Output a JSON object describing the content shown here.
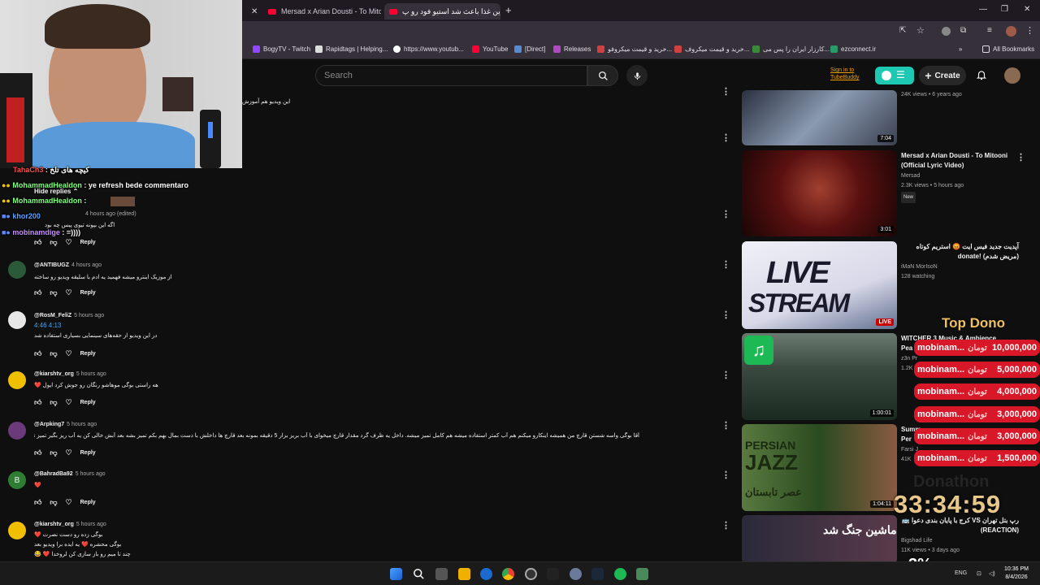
{
  "browser": {
    "tabs": [
      {
        "title": "Mersad x Arian Dousti - To Mito",
        "active": false
      },
      {
        "title": "این غذا باعث شد استیو فود رو پ",
        "active": true
      }
    ],
    "bookmarks": [
      "BogyTV - Twitch",
      "Rapidtags | Helping...",
      "https://www.youtub...",
      "YouTube",
      "[Direct]",
      "Releases",
      "خرید و قیمت میکروفو...",
      "خرید و قیمت میکروف...",
      "کارزار ایران را پس می...",
      "ezconnect.ir"
    ],
    "all_bookmarks": "All Bookmarks"
  },
  "header": {
    "search_placeholder": "Search",
    "signin_line1": "Sign in to",
    "signin_line2": "TubeBuddy",
    "create_label": "Create"
  },
  "comments": [
    {
      "author": "@ANTIBUGZ",
      "time": "4 hours ago",
      "text": "از موزیک اینترو میشه فهمید یه ادم با سلیقه ویدیو رو ساخته",
      "avatar_color": "#2a5a3a"
    },
    {
      "author": "@RosM_FeliZ",
      "time": "5 hours ago",
      "timestamps": "4:46  4:13",
      "text": "در این ویدیو از حقه‌های سینمایی بسیاری استفاده شد",
      "avatar_color": "#e8e8e8"
    },
    {
      "author": "@kiarshtv_org",
      "time": "5 hours ago",
      "text": "هه راستی بوگی موهاشو رنگان رو جوش کرد ایول ❤️",
      "avatar_color": "#f0c000"
    },
    {
      "author": "@Arpking7",
      "time": "5 hours ago",
      "text": "آقا بوگی واسه شستن قارچ من همیشه اینکارو میکنم هم آب کمتر استفاده میشه هم کامل تمیز میشه. داخل یه ظرف گرد مقدار قارچ میخوای با آب بریز بزار 5 دقیقه بمونه بعد قارچ ها داخلش با دست بمال بهم بکم تمیز بشه بعد آبش خالی کن یه آب ریز بگیر تمیز تمیز میشه",
      "avatar_color": "#6a3a7a"
    },
    {
      "author": "@BahradBa92",
      "time": "5 hours ago",
      "text": "❤️",
      "avatar_color": "#2e7d32",
      "avatar_letter": "B"
    },
    {
      "author": "@kiarshtv_org",
      "time": "5 hours ago",
      "text": "بوگی زده رو دست نصرت ❤️",
      "text2": "بوگی محشره ❤️ یه ایده برا ویدیو بعد",
      "text3": "چند تا میم رو باز سازی کن لروخدا ❤️ 😂",
      "avatar_color": "#f0c000"
    }
  ],
  "partial_comment": {
    "time": "4 hours ago (edited)",
    "text": "اگه این بپونه تیوی پیس چه بود",
    "top_text": "این ویدیو هم آموزش"
  },
  "comment_actions": {
    "reply": "Reply",
    "hide_replies": "Hide replies"
  },
  "sidebar": [
    {
      "title": "",
      "meta1": "24K views • 6 years ago",
      "duration": "7:04",
      "thumb": "#4a5a70"
    },
    {
      "title": "Mersad x Arian Dousti - To Mitooni (Official Lyric Video)",
      "channel": "Mersad",
      "meta1": "2.3K views • 5 hours ago",
      "badge": "New",
      "duration": "3:01",
      "thumb": "#5a1010"
    },
    {
      "title": "آپدیت جدید فیس ایت 😡 استریم کوتاه (مریض شدم) !donate",
      "channel": "iMaN MorIsoN",
      "meta1": "128 watching",
      "live": "LIVE",
      "thumb": "#e8e8f0"
    },
    {
      "title": "WITCHER 3 Music & Ambience",
      "title2": "Pea",
      "channel": "z3n Pr",
      "meta1": "1.2K",
      "duration": "1:00:01",
      "thumb": "#3a4a40"
    },
    {
      "title": "Summ",
      "title2": "Per",
      "channel": "Farsi J",
      "meta1": "41K",
      "duration": "1:04:11",
      "thumb": "#3a5a30",
      "thumb_text1": "PERSIAN",
      "thumb_text2": "JAZZ",
      "thumb_text3": "عصر تابستان"
    },
    {
      "title": "رپ بتل تهران VS کرج با پایان بندی دعوا 🚌 (REACTION)",
      "channel": "Bigshad Life",
      "meta1": "11K views • 3 days ago",
      "thumb": "#3a2a3a",
      "thumb_text1": "ماشین جنگ شد"
    }
  ],
  "overlay": {
    "chat": [
      {
        "name": "TahaCh3",
        "msg": "کیچه های تلخ"
      },
      {
        "name": "MohammadHealdon",
        "msg": "ye refresh bede commentaro"
      },
      {
        "name": "MohammadHealdon",
        "msg": ""
      },
      {
        "name": "khor200",
        "msg": ""
      },
      {
        "name": "mobinamdige",
        "msg": "=))))"
      }
    ],
    "top_dono_title": "Top Dono",
    "donations": [
      {
        "name": "mobinam...",
        "currency": "تومان",
        "amount": "10,000,000"
      },
      {
        "name": "mobinam...",
        "currency": "تومان",
        "amount": "5,000,000"
      },
      {
        "name": "mobinam...",
        "currency": "تومان",
        "amount": "4,000,000"
      },
      {
        "name": "mobinam...",
        "currency": "تومان",
        "amount": "3,000,000"
      },
      {
        "name": "mobinam...",
        "currency": "تومان",
        "amount": "3,000,000"
      },
      {
        "name": "mobinam...",
        "currency": "تومان",
        "amount": "1,500,000"
      }
    ],
    "donathon_label": "Donathon",
    "timer": "33:34:59",
    "percent": "3%"
  },
  "taskbar": {
    "lang": "ENG",
    "time": "10:36 PM",
    "date": "8/4/2026"
  }
}
